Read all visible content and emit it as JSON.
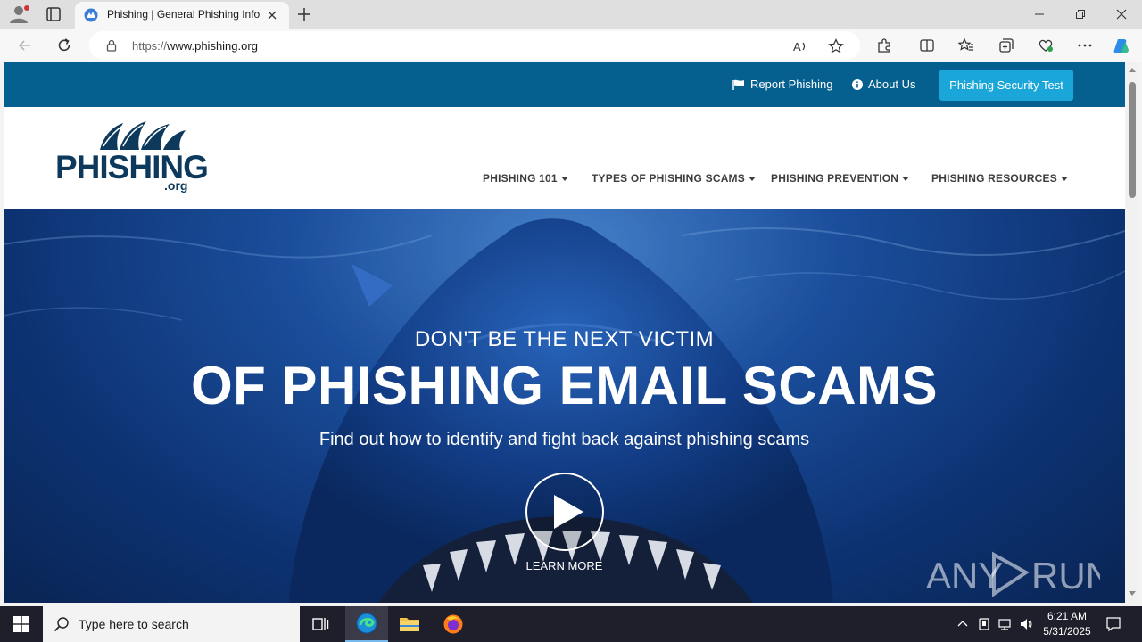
{
  "browser": {
    "tab_title": "Phishing | General Phishing Information",
    "url_scheme": "https://",
    "url_host": "www.phishing.org"
  },
  "site": {
    "top_links": {
      "report": "Report Phishing",
      "about": "About Us",
      "security_test": "Phishing Security Test"
    },
    "logo": {
      "main": "PHISHING",
      "suffix": ".org"
    },
    "menu": [
      "PHISHING 101",
      "TYPES OF PHISHING SCAMS",
      "PHISHING PREVENTION",
      "PHISHING RESOURCES"
    ],
    "hero": {
      "kicker": "DON'T BE THE NEXT VICTIM",
      "headline": "OF PHISHING EMAIL SCAMS",
      "subtitle": "Find out how to identify and fight back against phishing scams",
      "cta": "LEARN MORE"
    },
    "colors": {
      "topbar": "#055f8f",
      "button": "#1ba6d9",
      "logo": "#0d3a5c"
    }
  },
  "watermark": {
    "text_left": "ANY",
    "text_right": "RUN"
  },
  "taskbar": {
    "search_placeholder": "Type here to search",
    "time": "6:21 AM",
    "date": "5/31/2025"
  }
}
